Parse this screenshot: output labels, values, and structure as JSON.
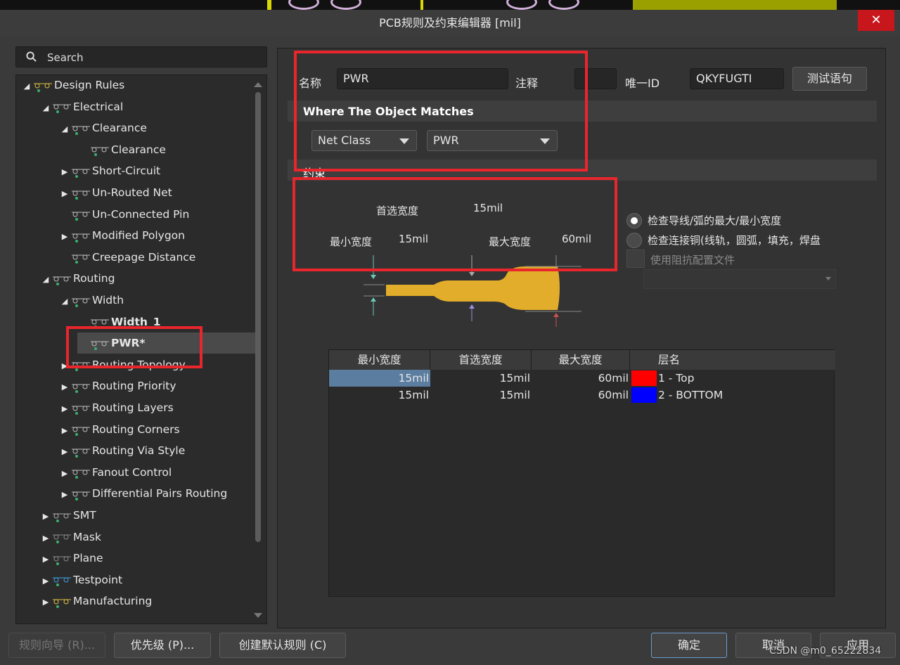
{
  "window": {
    "title": "PCB规则及约束编辑器 [mil]",
    "close": "✕"
  },
  "search": {
    "label": "Search"
  },
  "tree": [
    {
      "label": "Design Rules",
      "icon": "design-rules-icon",
      "toggle": "◢"
    },
    {
      "label": "Electrical",
      "icon": "electrical-icon",
      "toggle": "◢"
    },
    {
      "label": "Clearance",
      "icon": "clearance-icon",
      "toggle": "◢"
    },
    {
      "label": "Clearance",
      "icon": "clearance-icon",
      "toggle": ""
    },
    {
      "label": "Short-Circuit",
      "icon": "short-circuit-icon",
      "toggle": "▶"
    },
    {
      "label": "Un-Routed Net",
      "icon": "unrouted-net-icon",
      "toggle": "▶"
    },
    {
      "label": "Un-Connected Pin",
      "icon": "unconnected-pin-icon",
      "toggle": ""
    },
    {
      "label": "Modified Polygon",
      "icon": "modified-polygon-icon",
      "toggle": "▶"
    },
    {
      "label": "Creepage Distance",
      "icon": "creepage-icon",
      "toggle": ""
    },
    {
      "label": "Routing",
      "icon": "routing-icon",
      "toggle": "◢"
    },
    {
      "label": "Width",
      "icon": "width-icon",
      "toggle": "◢"
    },
    {
      "label": "Width_1",
      "icon": "width-rule-icon",
      "toggle": ""
    },
    {
      "label": "PWR*",
      "icon": "width-rule-icon",
      "toggle": ""
    },
    {
      "label": "Routing Topology",
      "icon": "routing-topology-icon",
      "toggle": "▶"
    },
    {
      "label": "Routing Priority",
      "icon": "routing-priority-icon",
      "toggle": "▶"
    },
    {
      "label": "Routing Layers",
      "icon": "routing-layers-icon",
      "toggle": "▶"
    },
    {
      "label": "Routing Corners",
      "icon": "routing-corners-icon",
      "toggle": "▶"
    },
    {
      "label": "Routing Via Style",
      "icon": "routing-via-icon",
      "toggle": "▶"
    },
    {
      "label": "Fanout Control",
      "icon": "fanout-icon",
      "toggle": "▶"
    },
    {
      "label": "Differential Pairs Routing",
      "icon": "diff-pairs-icon",
      "toggle": "▶"
    },
    {
      "label": "SMT",
      "icon": "smt-icon",
      "toggle": "▶"
    },
    {
      "label": "Mask",
      "icon": "mask-icon",
      "toggle": "▶"
    },
    {
      "label": "Plane",
      "icon": "plane-icon",
      "toggle": "▶"
    },
    {
      "label": "Testpoint",
      "icon": "testpoint-icon",
      "toggle": "▶"
    },
    {
      "label": "Manufacturing",
      "icon": "manufacturing-icon",
      "toggle": "▶"
    }
  ],
  "rule": {
    "name_label": "名称",
    "name_value": "PWR",
    "comment_label": "注释",
    "comment_value": "",
    "uid_label": "唯一ID",
    "uid_value": "QKYFUGTI",
    "test_button": "测试语句"
  },
  "match": {
    "header": "Where The Object Matches",
    "type": "Net Class",
    "value": "PWR"
  },
  "constraints": {
    "header": "约束",
    "preferred_label": "首选宽度",
    "preferred_value": "15mil",
    "min_label": "最小宽度",
    "min_value": "15mil",
    "max_label": "最大宽度",
    "max_value": "60mil",
    "radio1": "检查导线/弧的最大/最小宽度",
    "radio2": "检查连接铜(线轨，圆弧，填充，焊盘",
    "impedance": "使用阻抗配置文件"
  },
  "table": {
    "headers": [
      "最小宽度",
      "首选宽度",
      "最大宽度",
      "层名"
    ],
    "rows": [
      {
        "min": "15mil",
        "pref": "15mil",
        "max": "60mil",
        "color": "#ff0000",
        "layer": "1 - Top"
      },
      {
        "min": "15mil",
        "pref": "15mil",
        "max": "60mil",
        "color": "#0000ff",
        "layer": "2 - BOTTOM"
      }
    ]
  },
  "buttons": {
    "wizard": "规则向导 (R)...",
    "priority": "优先级 (P)...",
    "create_default": "创建默认规则 (C)",
    "ok": "确定",
    "cancel": "取消",
    "apply": "应用"
  },
  "watermark": "CSDN @m0_65222834"
}
